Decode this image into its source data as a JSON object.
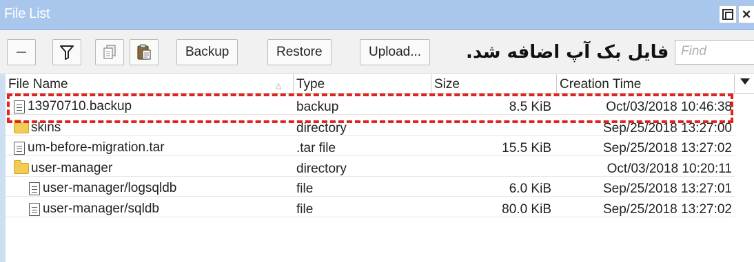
{
  "window": {
    "title": "File List",
    "controls": [
      "restore-icon",
      "close-icon"
    ]
  },
  "toolbar": {
    "icons": [
      "minus-icon",
      "filter-icon",
      "copy-icon",
      "paste-icon"
    ],
    "backup_label": "Backup",
    "restore_label": "Restore",
    "upload_label": "Upload...",
    "annotation_text": "فایل بک آپ اضافه شد.",
    "find_placeholder": "Find"
  },
  "table": {
    "columns": [
      "File Name",
      "Type",
      "Size",
      "Creation Time"
    ],
    "sort_column": "File Name",
    "rows": [
      {
        "name": "13970710.backup",
        "type": "backup",
        "size": "8.5 KiB",
        "time": "Oct/03/2018 10:46:38",
        "icon": "file-icon",
        "indent": 0
      },
      {
        "name": "skins",
        "type": "directory",
        "size": "",
        "time": "Sep/25/2018 13:27:00",
        "icon": "folder-icon",
        "indent": 0
      },
      {
        "name": "um-before-migration.tar",
        "type": ".tar file",
        "size": "15.5 KiB",
        "time": "Sep/25/2018 13:27:02",
        "icon": "file-icon",
        "indent": 0
      },
      {
        "name": "user-manager",
        "type": "directory",
        "size": "",
        "time": "Oct/03/2018 10:20:11",
        "icon": "folder-icon",
        "indent": 0
      },
      {
        "name": "user-manager/logsqldb",
        "type": "file",
        "size": "6.0 KiB",
        "time": "Sep/25/2018 13:27:01",
        "icon": "file-icon",
        "indent": 1
      },
      {
        "name": "user-manager/sqldb",
        "type": "file",
        "size": "80.0 KiB",
        "time": "Sep/25/2018 13:27:02",
        "icon": "file-icon",
        "indent": 1
      }
    ],
    "highlighted_row": "13970710.backup"
  },
  "colors": {
    "titlebar": "#a9c6ec",
    "highlight": "#e2231a",
    "folder": "#f3cc55"
  }
}
